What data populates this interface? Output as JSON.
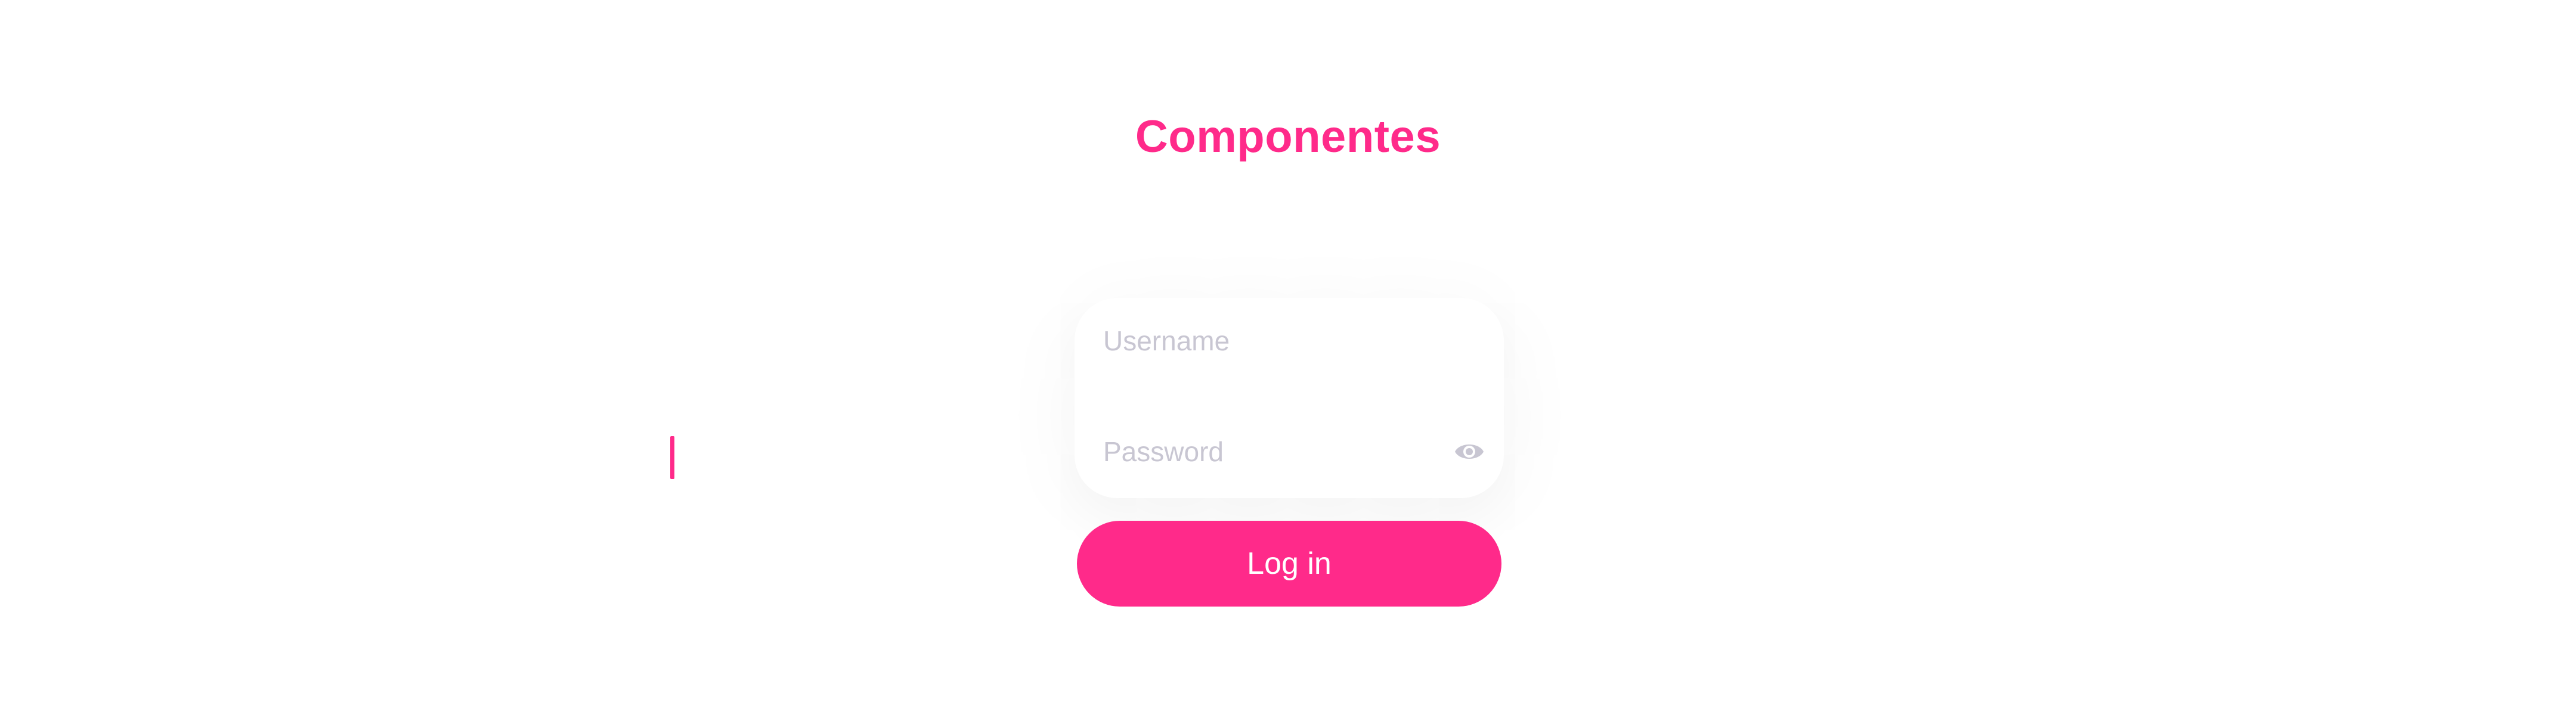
{
  "page": {
    "title": "Componentes"
  },
  "login_form": {
    "username": {
      "value": "",
      "placeholder": "Username"
    },
    "password": {
      "value": "",
      "placeholder": "Password",
      "toggle_icon": "eye-icon"
    },
    "submit_label": "Log in"
  },
  "colors": {
    "accent": "#ff2a8a",
    "placeholder": "#c8c6d2",
    "icon": "#c8c6d2",
    "background": "#ffffff"
  }
}
